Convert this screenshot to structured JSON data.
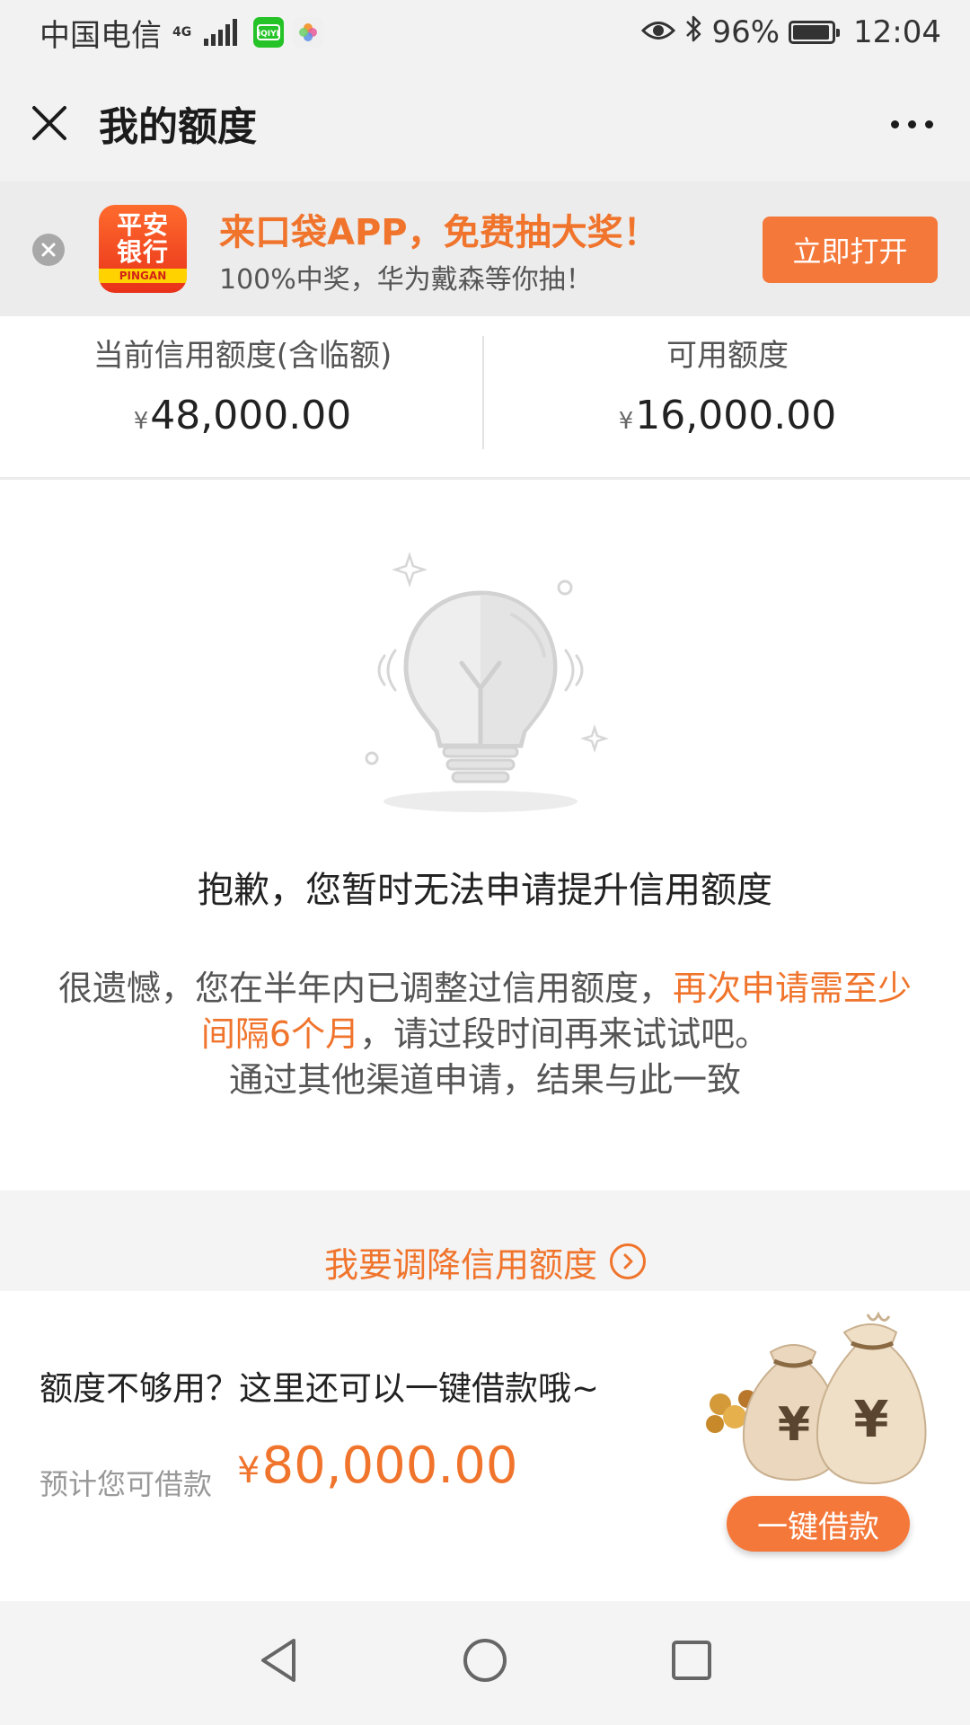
{
  "status_bar": {
    "carrier": "中国电信",
    "network": "4G",
    "battery": "96%",
    "time": "12:04",
    "battery_level": 0.96,
    "icons": [
      "signal-icon",
      "iqiyi-app-icon",
      "photos-app-icon",
      "eye-icon",
      "bluetooth-icon",
      "battery-icon"
    ]
  },
  "header": {
    "title": "我的额度",
    "close_icon": "close-icon",
    "more_icon": "more-icon"
  },
  "banner": {
    "logo_line1": "平安",
    "logo_line2": "银行",
    "logo_line3": "PINGAN",
    "title": "来口袋APP，免费抽大奖！",
    "subtitle": "100%中奖，华为戴森等你抽！",
    "open_button": "立即打开"
  },
  "credit": {
    "current_label": "当前信用额度(含临额)",
    "current_currency": "¥",
    "current_amount": "48,000.00",
    "available_label": "可用额度",
    "available_currency": "¥",
    "available_amount": "16,000.00"
  },
  "notice": {
    "title": "抱歉，您暂时无法申请提升信用额度",
    "text_part1": "很遗憾，您在半年内已调整过信用额度，",
    "text_highlight": "再次申请需至少间隔6个月",
    "text_part2": "，请过段时间再来试试吧。",
    "text_line3": "通过其他渠道申请，结果与此一致"
  },
  "reduce": {
    "label": "我要调降信用额度"
  },
  "loan": {
    "question": "额度不够用？这里还可以一键借款哦~",
    "estimate_label": "预计您可借款",
    "currency": "¥",
    "amount": "80,000.00",
    "button": "一键借款"
  },
  "colors": {
    "accent": "#f0742c",
    "button": "#f4783a",
    "background": "#f2f2f2"
  }
}
